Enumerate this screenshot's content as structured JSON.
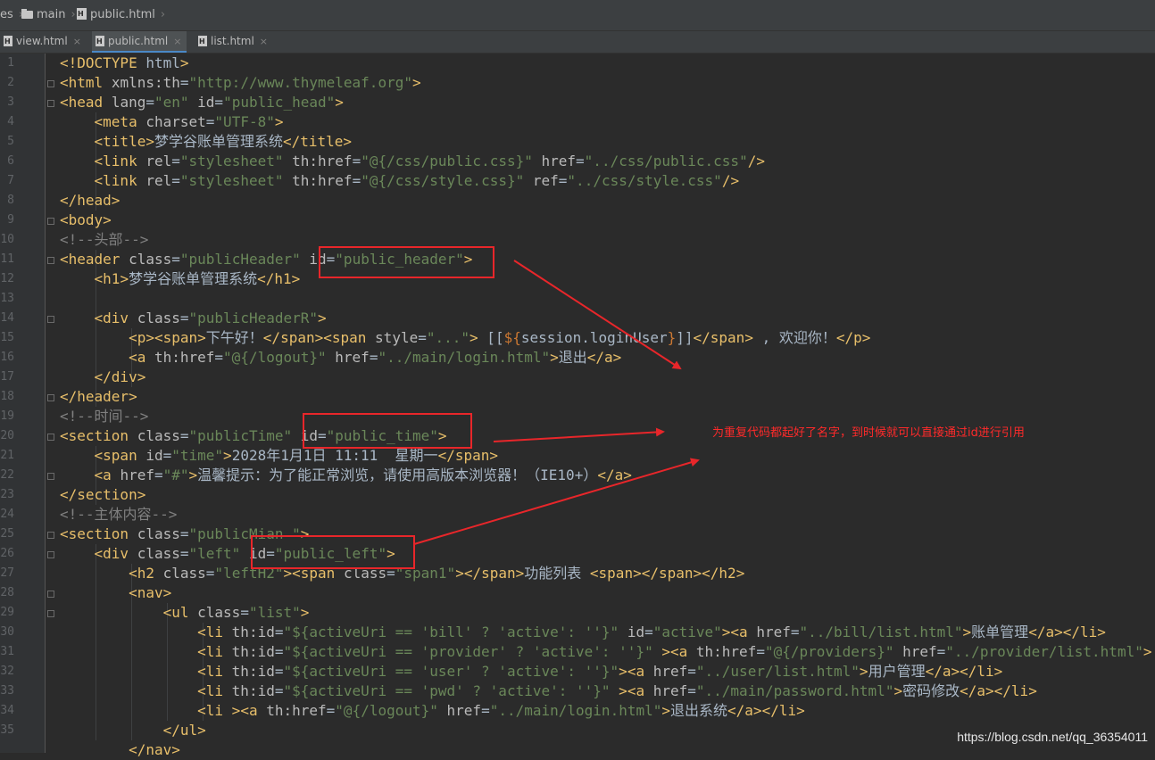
{
  "breadcrumb": [
    {
      "label": "es",
      "icon": "none"
    },
    {
      "label": "main",
      "icon": "folder-icon"
    },
    {
      "label": "public.html",
      "icon": "html-file-icon"
    }
  ],
  "tabs": [
    {
      "label": "view.html",
      "active": false
    },
    {
      "label": "public.html",
      "active": true
    },
    {
      "label": "list.html",
      "active": false
    }
  ],
  "tab_close_glyph": "×",
  "line_numbers": [
    "1",
    "2",
    "3",
    "4",
    "5",
    "6",
    "7",
    "8",
    "9",
    "10",
    "11",
    "12",
    "13",
    "14",
    "15",
    "16",
    "17",
    "18",
    "19",
    "20",
    "21",
    "22",
    "23",
    "24",
    "25",
    "26",
    "27",
    "28",
    "29",
    "30",
    "31",
    "32",
    "33",
    "34",
    "35"
  ],
  "code_lines": [
    "<!DOCTYPE html>",
    "<html xmlns:th=\"http://www.thymeleaf.org\">",
    "<head lang=\"en\" id=\"public_head\">",
    "    <meta charset=\"UTF-8\">",
    "    <title>梦学谷账单管理系统</title>",
    "    <link rel=\"stylesheet\" th:href=\"@{/css/public.css}\" href=\"../css/public.css\"/>",
    "    <link rel=\"stylesheet\" th:href=\"@{/css/style.css}\" ref=\"../css/style.css\"/>",
    "</head>",
    "<body>",
    "<!--头部-->",
    "<header class=\"publicHeader\" id=\"public_header\">",
    "    <h1>梦学谷账单管理系统</h1>",
    "",
    "    <div class=\"publicHeaderR\">",
    "        <p><span>下午好！</span><span style=\"...\"> [[${session.loginUser}]]</span> , 欢迎你！</p>",
    "        <a th:href=\"@{/logout}\" href=\"../main/login.html\">退出</a>",
    "    </div>",
    "</header>",
    "<!--时间-->",
    "<section class=\"publicTime\" id=\"public_time\">",
    "    <span id=\"time\">2028年1月1日 11:11  星期一</span>",
    "    <a href=\"#\">温馨提示：为了能正常浏览，请使用高版本浏览器！（IE10+）</a>",
    "</section>",
    "<!--主体内容-->",
    "<section class=\"publicMian \">",
    "    <div class=\"left\" id=\"public_left\">",
    "        <h2 class=\"leftH2\"><span class=\"span1\"></span>功能列表 <span></span></h2>",
    "        <nav>",
    "            <ul class=\"list\">",
    "                <li th:id=\"${activeUri == 'bill' ? 'active': ''}\" id=\"active\"><a href=\"../bill/list.html\">账单管理</a></li>",
    "                <li th:id=\"${activeUri == 'provider' ? 'active': ''}\" ><a th:href=\"@{/providers}\" href=\"../provider/list.html\">",
    "                <li th:id=\"${activeUri == 'user' ? 'active': ''}\"><a href=\"../user/list.html\">用户管理</a></li>",
    "                <li th:id=\"${activeUri == 'pwd' ? 'active': ''}\" ><a href=\"../main/password.html\">密码修改</a></li>",
    "                <li ><a th:href=\"@{/logout}\" href=\"../main/login.html\">退出系统</a></li>",
    "            </ul>",
    "        </nav>"
  ],
  "annotation_text": "为重复代码都起好了名字，到时候就可以直接通过id进行引用",
  "watermark": "https://blog.csdn.net/qq_36354011",
  "colors": {
    "highlight_box": "#e8262a",
    "annotation": "#ff2a2a",
    "tag": "#e8bf6a",
    "string": "#6a8759",
    "comment": "#808080",
    "background": "#2b2b2b"
  }
}
